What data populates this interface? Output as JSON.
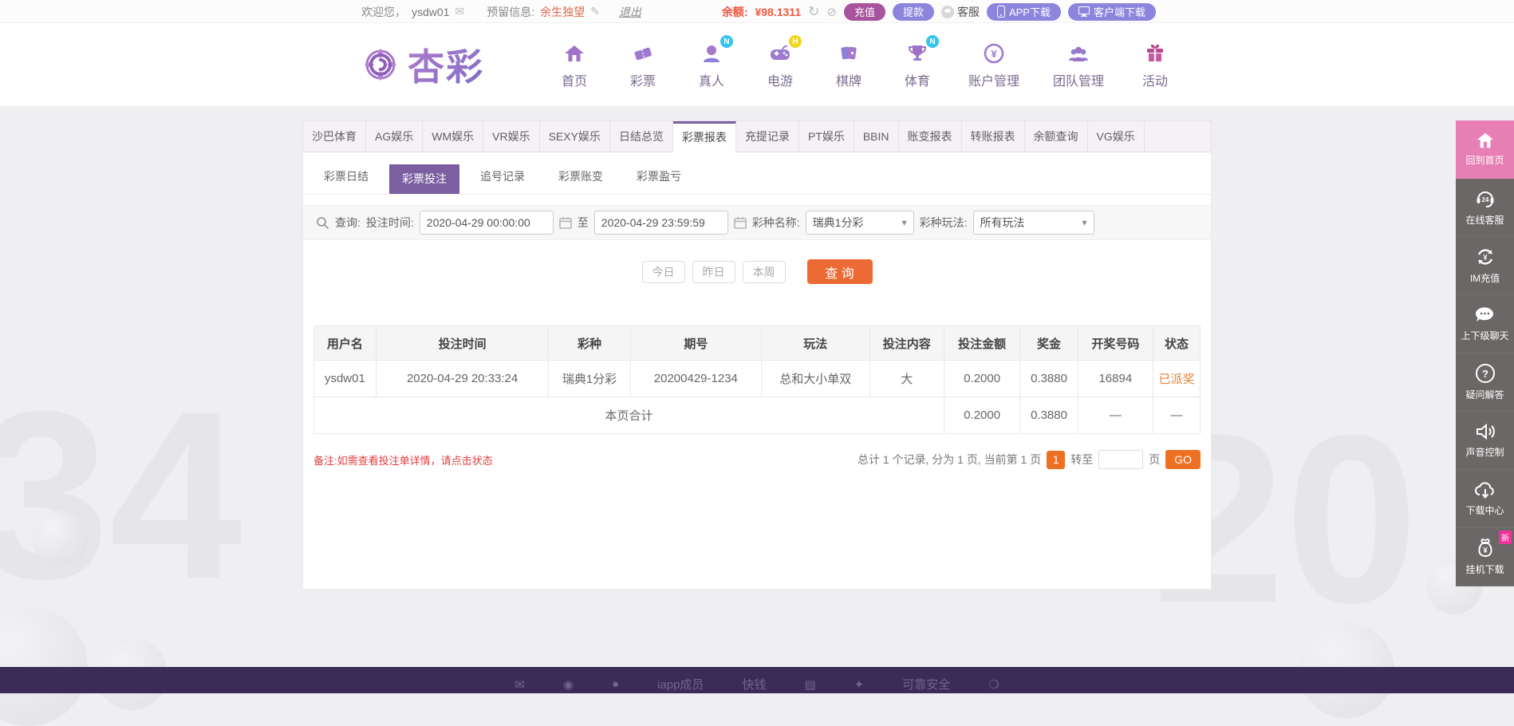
{
  "topbar": {
    "welcome": "欢迎您，",
    "username": "ysdw01",
    "reserved_label": "预留信息:",
    "reserved_value": "余生独望",
    "logout": "退出",
    "balance_label": "余额:",
    "balance_value": "¥98.1311",
    "recharge": "充值",
    "withdraw": "提款",
    "service": "客服",
    "app_download": "APP下载",
    "client_download": "客户端下载"
  },
  "icons": {
    "envelope": "✉",
    "edit": "✎",
    "refresh": "↻",
    "eye_off": "⊘",
    "caret": "▾"
  },
  "header": {
    "logo_text": "杏彩",
    "nav": [
      {
        "label": "首页",
        "badge": ""
      },
      {
        "label": "彩票",
        "badge": ""
      },
      {
        "label": "真人",
        "badge": "N"
      },
      {
        "label": "电游",
        "badge": "H"
      },
      {
        "label": "棋牌",
        "badge": ""
      },
      {
        "label": "体育",
        "badge": "N"
      },
      {
        "label": "账户管理",
        "badge": ""
      },
      {
        "label": "团队管理",
        "badge": ""
      },
      {
        "label": "活动",
        "badge": ""
      }
    ]
  },
  "tabs": [
    "沙巴体育",
    "AG娱乐",
    "WM娱乐",
    "VR娱乐",
    "SEXY娱乐",
    "日结总览",
    "彩票报表",
    "充提记录",
    "PT娱乐",
    "BBIN",
    "账变报表",
    "转账报表",
    "余额查询",
    "VG娱乐"
  ],
  "subtabs": [
    "彩票日结",
    "彩票投注",
    "追号记录",
    "彩票账变",
    "彩票盈亏"
  ],
  "filters": {
    "search_label": "查询:",
    "time_label": "投注时间:",
    "time_from": "2020-04-29 00:00:00",
    "to_label": "至",
    "time_to": "2020-04-29 23:59:59",
    "lottery_label": "彩种名称:",
    "lottery_value": "瑞典1分彩",
    "play_label": "彩种玩法:",
    "play_value": "所有玩法",
    "quick": [
      "今日",
      "昨日",
      "本周"
    ],
    "submit": "查 询"
  },
  "table": {
    "headers": [
      "用户名",
      "投注时间",
      "彩种",
      "期号",
      "玩法",
      "投注内容",
      "投注金额",
      "奖金",
      "开奖号码",
      "状态"
    ],
    "rows": [
      [
        "ysdw01",
        "2020-04-29 20:33:24",
        "瑞典1分彩",
        "20200429-1234",
        "总和大小单双",
        "大",
        "0.2000",
        "0.3880",
        "16894",
        "已派奖"
      ]
    ],
    "total_label": "本页合计",
    "total": [
      "0.2000",
      "0.3880",
      "—",
      "—"
    ]
  },
  "note": "备注:如需查看投注单详情，请点击状态",
  "pagination": {
    "summary": "总计 1 个记录, 分为 1 页, 当前第 1 页",
    "current_page": "1",
    "goto_label": "转至",
    "page_label": "页",
    "go_label": "GO"
  },
  "sidebar": [
    {
      "label": "回到首页",
      "badge": ""
    },
    {
      "label": "在线客服",
      "badge": ""
    },
    {
      "label": "IM充值",
      "badge": ""
    },
    {
      "label": "上下级聊天",
      "badge": ""
    },
    {
      "label": "疑问解答",
      "badge": ""
    },
    {
      "label": "声音控制",
      "badge": ""
    },
    {
      "label": "下载中心",
      "badge": ""
    },
    {
      "label": "挂机下载",
      "badge": "新"
    }
  ],
  "footer": {
    "logos": [
      "✉",
      "◉",
      "●",
      "iapp成员",
      "快钱",
      "▤",
      "✦",
      "可靠安全",
      "❍"
    ]
  },
  "background": {
    "left_watermark": "34",
    "right_watermark": "20"
  }
}
